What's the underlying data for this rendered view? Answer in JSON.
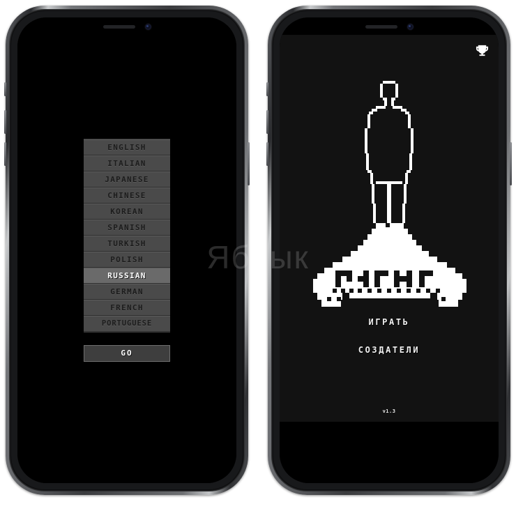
{
  "watermark": "Яблык",
  "left_phone": {
    "label": "language-select-screen",
    "languages": [
      {
        "label": "ENGLISH",
        "selected": false
      },
      {
        "label": "ITALIAN",
        "selected": false
      },
      {
        "label": "JAPANESE",
        "selected": false
      },
      {
        "label": "CHINESE",
        "selected": false
      },
      {
        "label": "KOREAN",
        "selected": false
      },
      {
        "label": "SPANISH",
        "selected": false
      },
      {
        "label": "TURKISH",
        "selected": false
      },
      {
        "label": "POLISH",
        "selected": false
      },
      {
        "label": "RUSSIAN",
        "selected": true
      },
      {
        "label": "GERMAN",
        "selected": false
      },
      {
        "label": "FRENCH",
        "selected": false
      },
      {
        "label": "PORTUGUESE",
        "selected": false
      }
    ],
    "go_label": "GO"
  },
  "right_phone": {
    "label": "game-title-screen",
    "trophy_icon": "trophy-icon",
    "logo_alt": "pixel-figure-on-mountain-logo",
    "menu": [
      {
        "label": "ИГРАТЬ"
      },
      {
        "label": "СОЗДАТЕЛИ"
      }
    ],
    "version": "v1.3"
  },
  "colors": {
    "screen_black": "#000000",
    "canvas_dark": "#121212",
    "list_item_bg": "#4a4a4a",
    "list_item_selected_bg": "#6a6a6a",
    "list_item_text": "#1c1c1c",
    "list_item_selected_text": "#ffffff",
    "logo_white": "#ffffff"
  }
}
